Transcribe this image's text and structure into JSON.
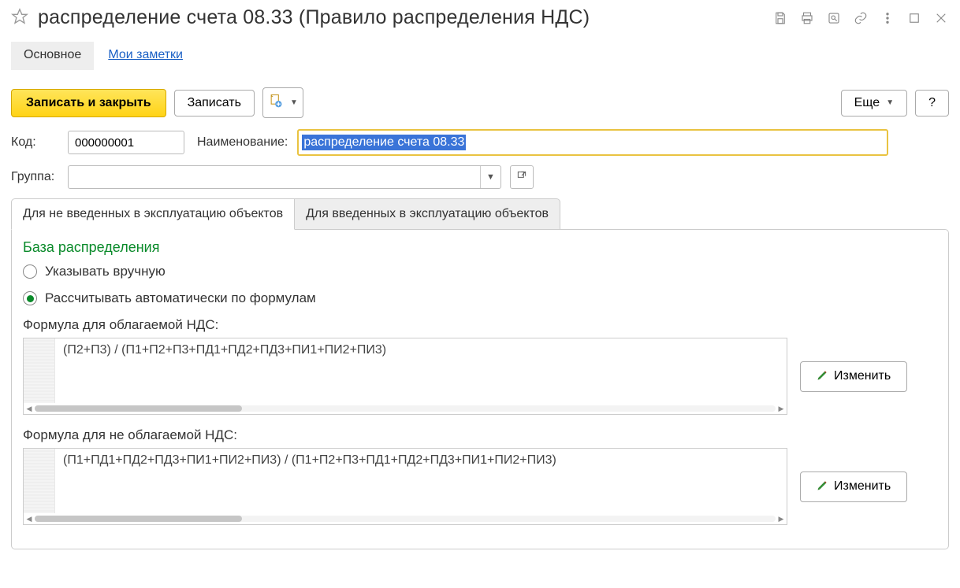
{
  "header": {
    "title": "распределение счета 08.33 (Правило распределения НДС)"
  },
  "nav": {
    "main": "Основное",
    "notes": "Мои заметки"
  },
  "toolbar": {
    "save_close": "Записать и закрыть",
    "save": "Записать",
    "more": "Еще",
    "help": "?"
  },
  "form": {
    "code_label": "Код:",
    "code_value": "000000001",
    "name_label": "Наименование:",
    "name_value": "распределение счета 08.33",
    "group_label": "Группа:",
    "group_value": ""
  },
  "subtabs": {
    "not_commissioned": "Для не введенных в эксплуатацию объектов",
    "commissioned": "Для введенных в эксплуатацию объектов"
  },
  "panel": {
    "section_title": "База распределения",
    "radio_manual": "Указывать вручную",
    "radio_auto": "Рассчитывать автоматически по формулам",
    "formula_vat_label": "Формула для облагаемой НДС:",
    "formula_vat_value": "(П2+П3) /  (П1+П2+П3+ПД1+ПД2+ПД3+ПИ1+ПИ2+ПИ3)",
    "formula_novat_label": "Формула для не облагаемой НДС:",
    "formula_novat_value": "(П1+ПД1+ПД2+ПД3+ПИ1+ПИ2+ПИ3) /  (П1+П2+П3+ПД1+ПД2+ПД3+ПИ1+ПИ2+ПИ3)",
    "edit": "Изменить"
  }
}
